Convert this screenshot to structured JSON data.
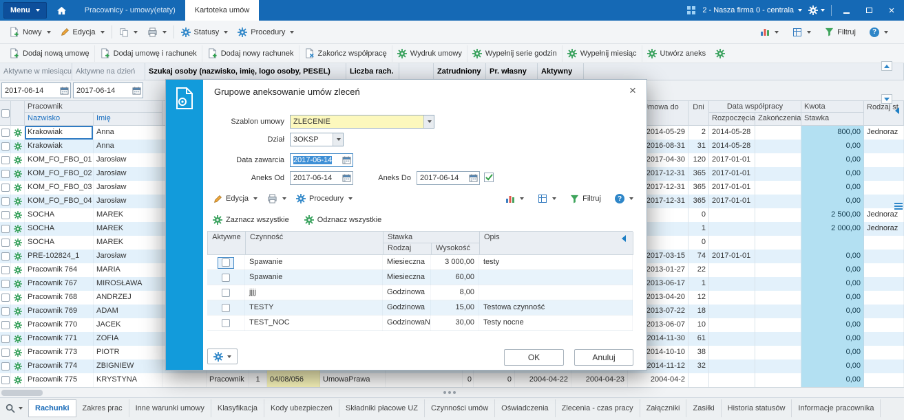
{
  "titlebar": {
    "menu_label": "Menu",
    "tab_inactive": "Pracownicy - umowy(etaty)",
    "tab_active": "Kartoteka umów",
    "company": "2 - Nasza firma 0 - centrala"
  },
  "toolbar": {
    "nowy": "Nowy",
    "edycja": "Edycja",
    "statusy": "Statusy",
    "procedury": "Procedury",
    "filtruj": "Filtruj",
    "help": "?"
  },
  "actions": [
    {
      "label": "Dodaj nową umowę",
      "icon": "docplus"
    },
    {
      "label": "Dodaj umowę i rachunek",
      "icon": "docplus"
    },
    {
      "label": "Dodaj nowy rachunek",
      "icon": "docplus"
    },
    {
      "label": "Zakończ współpracę",
      "icon": "docx"
    },
    {
      "label": "Wydruk umowy",
      "icon": "gear_g"
    },
    {
      "label": "Wypełnij serie godzin",
      "icon": "gear_g"
    },
    {
      "label": "Wypełnij miesiąc",
      "icon": "gear_g"
    },
    {
      "label": "Utwórz aneks",
      "icon": "gear_g"
    }
  ],
  "filters": {
    "col1": "Aktywne w miesiącu",
    "col2": "Aktywne na dzień",
    "szukaj": "Szukaj osoby (nazwisko, imię, logo osoby, PESEL)",
    "liczba": "Liczba rach.",
    "zatrudniony": "Zatrudniony",
    "pr_wlasny": "Pr. własny",
    "aktywny": "Aktywny",
    "date1": "2017-06-14",
    "date2": "2017-06-14"
  },
  "grid": {
    "pracownik": "Pracownik",
    "nazwisko": "Nazwisko",
    "imie": "Imię",
    "umowa_do": "Umowa do",
    "dni": "Dni",
    "wspolpraca": "Data współpracy",
    "rozpoczecia": "Rozpoczęcia",
    "zakonczenia": "Zakończenia",
    "kwota": "Kwota",
    "stawka": "Stawka",
    "rodzaj": "Rodzaj st",
    "rows": [
      {
        "nazwisko": "Krakowiak",
        "imie": "Anna",
        "umowa_do": "2014-05-29",
        "dni": "2",
        "rozpoczecia": "2014-05-28",
        "zakonczenia": "",
        "stawka": "800,00",
        "rodzaj": "Jednoraz",
        "selected": true
      },
      {
        "nazwisko": "Krakowiak",
        "imie": "Anna",
        "umowa_do": "2016-08-31",
        "dni": "31",
        "rozpoczecia": "2014-05-28",
        "zakonczenia": "",
        "stawka": "0,00",
        "rodzaj": ""
      },
      {
        "nazwisko": "KOM_FO_FBO_01",
        "imie": "Jarosław",
        "umowa_do": "2017-04-30",
        "dni": "120",
        "rozpoczecia": "2017-01-01",
        "zakonczenia": "",
        "stawka": "0,00",
        "rodzaj": ""
      },
      {
        "nazwisko": "KOM_FO_FBO_02",
        "imie": "Jarosław",
        "umowa_do": "2017-12-31",
        "dni": "365",
        "rozpoczecia": "2017-01-01",
        "zakonczenia": "",
        "stawka": "0,00",
        "rodzaj": ""
      },
      {
        "nazwisko": "KOM_FO_FBO_03",
        "imie": "Jarosław",
        "umowa_do": "2017-12-31",
        "dni": "365",
        "rozpoczecia": "2017-01-01",
        "zakonczenia": "",
        "stawka": "0,00",
        "rodzaj": ""
      },
      {
        "nazwisko": "KOM_FO_FBO_04",
        "imie": "Jarosław",
        "umowa_do": "2017-12-31",
        "dni": "365",
        "rozpoczecia": "2017-01-01",
        "zakonczenia": "",
        "stawka": "0,00",
        "rodzaj": ""
      },
      {
        "nazwisko": "SOCHA",
        "imie": "MAREK",
        "umowa_do": "",
        "dni": "0",
        "rozpoczecia": "",
        "zakonczenia": "",
        "stawka": "2 500,00",
        "rodzaj": "Jednoraz"
      },
      {
        "nazwisko": "SOCHA",
        "imie": "MAREK",
        "umowa_do": "",
        "dni": "1",
        "rozpoczecia": "",
        "zakonczenia": "",
        "stawka": "2 000,00",
        "rodzaj": "Jednoraz"
      },
      {
        "nazwisko": "SOCHA",
        "imie": "MAREK",
        "umowa_do": "",
        "dni": "0",
        "rozpoczecia": "",
        "zakonczenia": "",
        "stawka": "",
        "rodzaj": ""
      },
      {
        "nazwisko": "PRE-102824_1",
        "imie": "Jarosław",
        "umowa_do": "2017-03-15",
        "dni": "74",
        "rozpoczecia": "2017-01-01",
        "zakonczenia": "",
        "stawka": "0,00",
        "rodzaj": ""
      },
      {
        "nazwisko": "Pracownik 764",
        "imie": "MARIA",
        "umowa_do": "2013-01-27",
        "dni": "22",
        "rozpoczecia": "",
        "zakonczenia": "",
        "stawka": "0,00",
        "rodzaj": ""
      },
      {
        "nazwisko": "Pracownik 767",
        "imie": "MIROSŁAWA",
        "umowa_do": "2013-06-17",
        "dni": "1",
        "rozpoczecia": "",
        "zakonczenia": "",
        "stawka": "0,00",
        "rodzaj": ""
      },
      {
        "nazwisko": "Pracownik 768",
        "imie": "ANDRZEJ",
        "umowa_do": "2013-04-20",
        "dni": "12",
        "rozpoczecia": "",
        "zakonczenia": "",
        "stawka": "0,00",
        "rodzaj": ""
      },
      {
        "nazwisko": "Pracownik 769",
        "imie": "ADAM",
        "umowa_do": "2013-07-22",
        "dni": "18",
        "rozpoczecia": "",
        "zakonczenia": "",
        "stawka": "0,00",
        "rodzaj": ""
      },
      {
        "nazwisko": "Pracownik 770",
        "imie": "JACEK",
        "umowa_do": "2013-06-07",
        "dni": "10",
        "rozpoczecia": "",
        "zakonczenia": "",
        "stawka": "0,00",
        "rodzaj": ""
      },
      {
        "nazwisko": "Pracownik 771",
        "imie": "ZOFIA",
        "umowa_do": "2014-11-30",
        "dni": "61",
        "rozpoczecia": "",
        "zakonczenia": "",
        "stawka": "0,00",
        "rodzaj": ""
      },
      {
        "nazwisko": "Pracownik 773",
        "imie": "PIOTR",
        "umowa_do": "2014-10-10",
        "dni": "38",
        "rozpoczecia": "",
        "zakonczenia": "",
        "stawka": "0,00",
        "rodzaj": ""
      },
      {
        "nazwisko": "Pracownik 774",
        "imie": "ZBIGNIEW",
        "umowa_do": "2014-11-12",
        "dni": "32",
        "rozpoczecia": "",
        "zakonczenia": "",
        "stawka": "0,00",
        "rodzaj": ""
      },
      {
        "nazwisko": "Pracownik 775",
        "imie": "KRYSTYNA",
        "typ": "Pracownik",
        "nr": "1",
        "nr_umowy": "04/08/056",
        "rodzaj_umowy": "UmowaPrawa",
        "v1": "0",
        "v2": "0",
        "d1": "2004-04-22",
        "d2": "2004-04-23",
        "umowa_do": "2004-04-2",
        "dni": "",
        "rozpoczecia": "",
        "zakonczenia": "",
        "stawka": "0,00",
        "rodzaj": ""
      }
    ]
  },
  "dialog": {
    "title": "Grupowe aneksowanie umów zleceń",
    "szablon_label": "Szablon umowy",
    "szablon_value": "ZLECENIE",
    "dzial_label": "Dział",
    "dzial_value": "3OKSP",
    "data_zawarcia_label": "Data zawarcia",
    "data_zawarcia_value": "2017-06-14",
    "aneks_od_label": "Aneks Od",
    "aneks_od_value": "2017-06-14",
    "aneks_do_label": "Aneks Do",
    "aneks_do_value": "2017-06-14",
    "edycja": "Edycja",
    "procedury": "Procedury",
    "filtruj": "Filtruj",
    "help": "?",
    "zaznacz": "Zaznacz wszystkie",
    "odznacz": "Odznacz wszystkie",
    "col_aktywne": "Aktywne",
    "col_czynnosc": "Czynność",
    "col_stawka": "Stawka",
    "col_rodzaj": "Rodzaj",
    "col_wysokosc": "Wysokość",
    "col_opis": "Opis",
    "rows": [
      {
        "czynnosc": "Spawanie",
        "rodzaj": "Miesieczna",
        "wysokosc": "3 000,00",
        "opis": "testy",
        "focused": true
      },
      {
        "czynnosc": "Spawanie",
        "rodzaj": "Miesieczna",
        "wysokosc": "60,00",
        "opis": ""
      },
      {
        "czynnosc": "jjjj",
        "rodzaj": "Godzinowa",
        "wysokosc": "8,00",
        "opis": ""
      },
      {
        "czynnosc": "TESTY",
        "rodzaj": "Godzinowa",
        "wysokosc": "15,00",
        "opis": "Testowa czynność"
      },
      {
        "czynnosc": "TEST_NOC",
        "rodzaj": "GodzinowaN",
        "wysokosc": "30,00",
        "opis": "Testy nocne"
      }
    ],
    "ok": "OK",
    "anuluj": "Anuluj"
  },
  "bottom_tabs": [
    {
      "label": "Rachunki",
      "active": true
    },
    {
      "label": "Zakres prac"
    },
    {
      "label": "Inne warunki umowy"
    },
    {
      "label": "Klasyfikacja"
    },
    {
      "label": "Kody ubezpieczeń"
    },
    {
      "label": "Składniki płacowe UZ"
    },
    {
      "label": "Czynności umów"
    },
    {
      "label": "Oświadczenia"
    },
    {
      "label": "Zlecenia - czas pracy"
    },
    {
      "label": "Załączniki"
    },
    {
      "label": "Zasiłki"
    },
    {
      "label": "Historia statusów"
    },
    {
      "label": "Informacje pracownika"
    }
  ],
  "colors": {
    "accent": "#1569b5",
    "stripe": "#129bdb",
    "kwota_bg": "#b3e0f2",
    "highlight_yellow": "#fcf8bd"
  }
}
